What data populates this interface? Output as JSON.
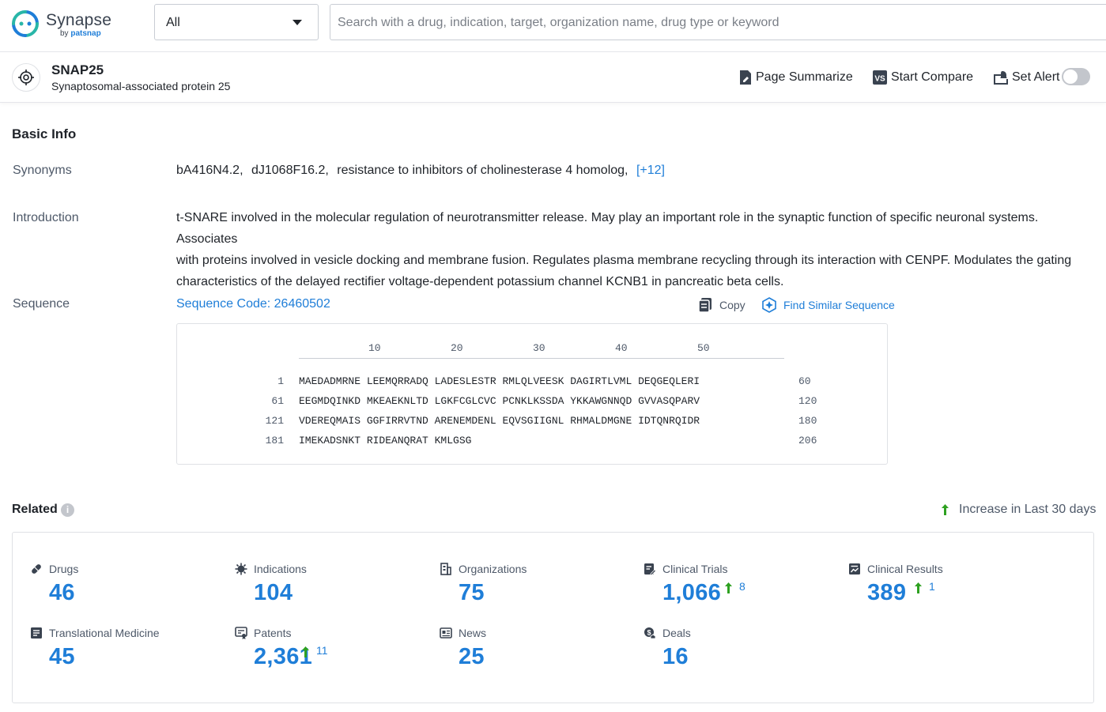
{
  "app": {
    "name": "Synapse",
    "by_prefix": "by",
    "by_brand": "patsnap"
  },
  "search": {
    "scope": "All",
    "placeholder": "Search with a drug, indication, target, organization name, drug type or keyword",
    "value": ""
  },
  "target": {
    "symbol": "SNAP25",
    "full_name": "Synaptosomal-associated protein 25"
  },
  "actions": {
    "summarize": "Page Summarize",
    "compare": "Start Compare",
    "alert": "Set Alert",
    "alert_on": false
  },
  "basic_info": {
    "title": "Basic Info",
    "synonyms_label": "Synonyms",
    "synonyms": [
      "bA416N4.2,",
      "dJ1068F16.2,",
      "resistance to inhibitors of cholinesterase 4 homolog,"
    ],
    "synonyms_more": "[+12]",
    "intro_label": "Introduction",
    "intro_lines": [
      "t-SNARE involved in the molecular regulation of neurotransmitter release. May play an important role in the synaptic function of specific neuronal systems. Associates",
      "with proteins involved in vesicle docking and membrane fusion. Regulates plasma membrane recycling through its interaction with CENPF. Modulates the gating",
      "characteristics of the delayed rectifier voltage-dependent potassium channel KCNB1 in pancreatic beta cells."
    ],
    "sequence_label": "Sequence",
    "sequence_code": "Sequence Code: 26460502",
    "copy": "Copy",
    "find_similar": "Find Similar Sequence"
  },
  "sequence": {
    "ticks": [
      "10",
      "20",
      "30",
      "40",
      "50"
    ],
    "rows": [
      {
        "start": "1",
        "residues": "MAEDADMRNE LEEMQRRADQ LADESLESTR RMLQLVEESK DAGIRTLVML DEQGEQLERI",
        "end": "60"
      },
      {
        "start": "61",
        "residues": "EEGMDQINKD MKEAEKNLTD LGKFCGLCVC PCNKLKSSDA YKKAWGNNQD GVVASQPARV",
        "end": "120"
      },
      {
        "start": "121",
        "residues": "VDEREQMAIS GGFIRRVTND ARENEMDENL EQVSGIIGNL RHMALDMGNE IDTQNRQIDR",
        "end": "180"
      },
      {
        "start": "181",
        "residues": "IMEKADSNKT RIDEANQRAT KMLGSG",
        "end": "206"
      }
    ]
  },
  "related": {
    "title": "Related",
    "info_glyph": "i",
    "legend": "Increase in Last 30 days",
    "up_color": "#2ea121",
    "items": [
      {
        "label": "Drugs",
        "value": "46",
        "icon": "pill-icon",
        "increase": ""
      },
      {
        "label": "Indications",
        "value": "104",
        "icon": "virus-icon",
        "increase": ""
      },
      {
        "label": "Organizations",
        "value": "75",
        "icon": "building-icon",
        "increase": ""
      },
      {
        "label": "Clinical Trials",
        "value": "1,066",
        "icon": "clipboard-edit-icon",
        "increase": "8"
      },
      {
        "label": "Clinical Results",
        "value": "389",
        "icon": "chart-doc-icon",
        "increase": "1"
      },
      {
        "label": "Translational Medicine",
        "value": "45",
        "icon": "doc-list-icon",
        "increase": ""
      },
      {
        "label": "Patents",
        "value": "2,361",
        "icon": "patent-icon",
        "increase": "11"
      },
      {
        "label": "News",
        "value": "25",
        "icon": "news-icon",
        "increase": ""
      },
      {
        "label": "Deals",
        "value": "16",
        "icon": "deal-icon",
        "increase": ""
      }
    ]
  }
}
